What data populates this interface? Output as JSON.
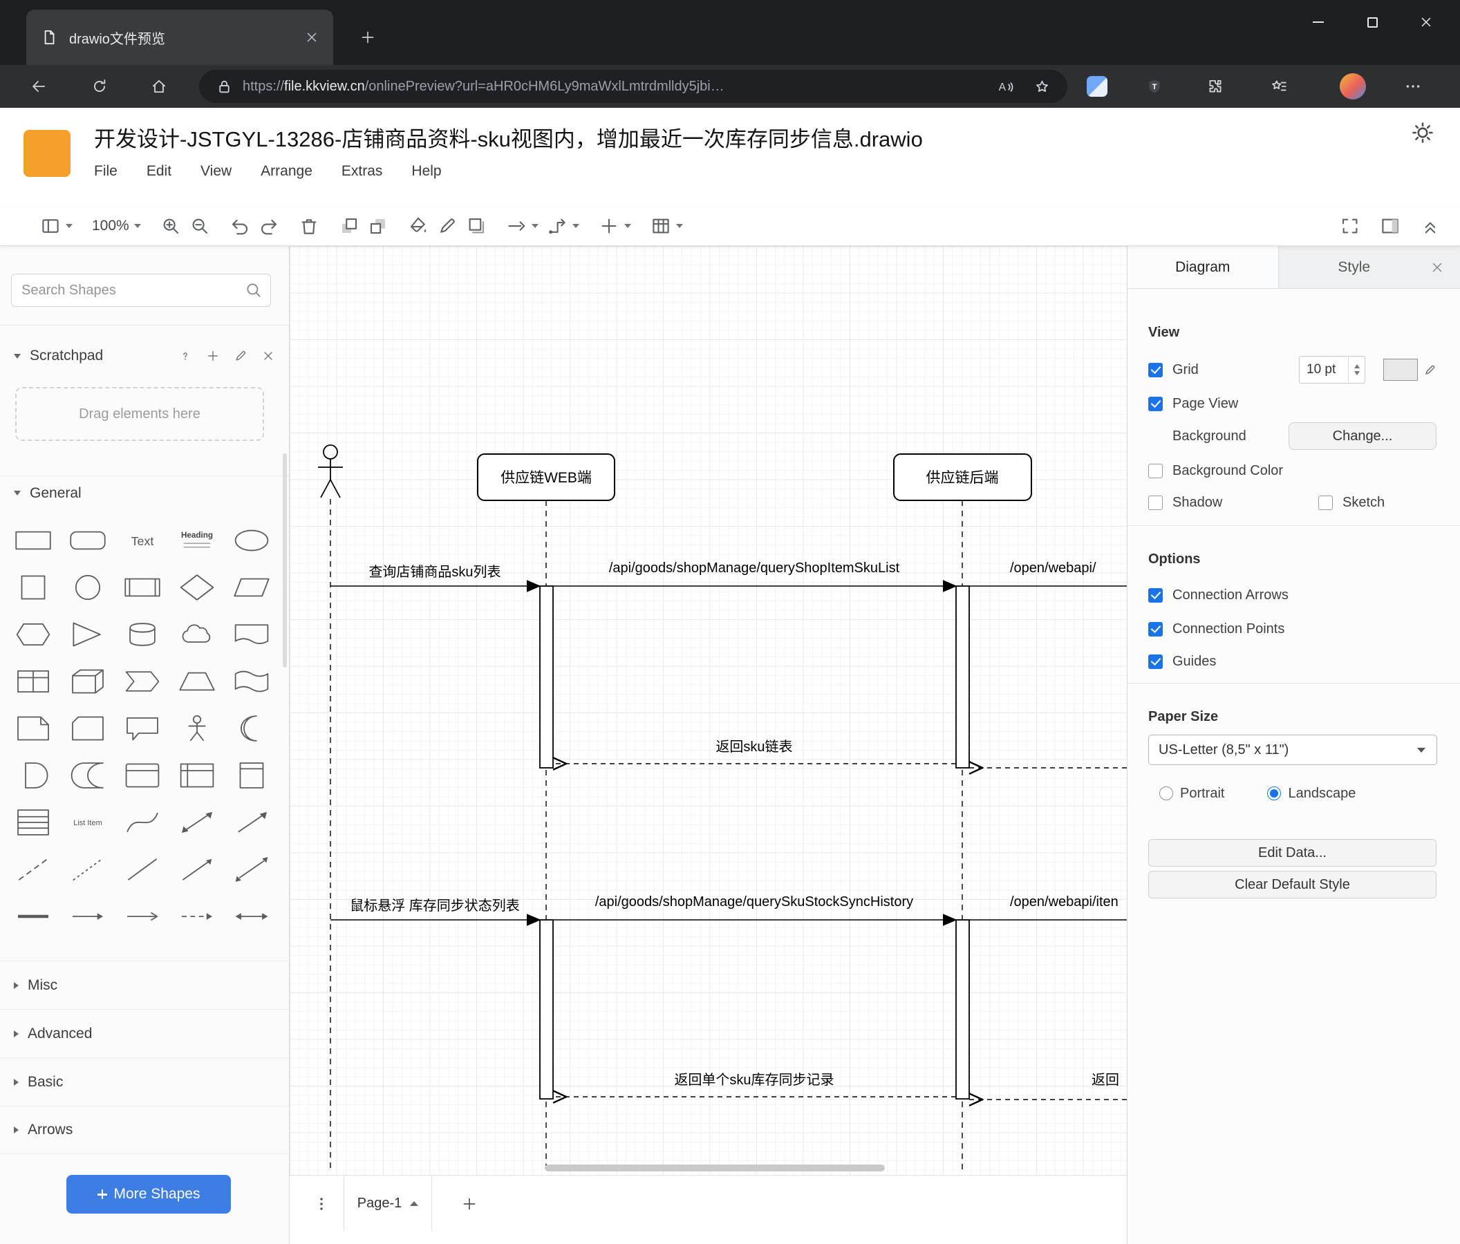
{
  "colors": {
    "accent": "#1a73e8",
    "logo_orange": "#F5A02B",
    "button_blue": "#3D7DE4"
  },
  "browser": {
    "tab_title": "drawio文件预览",
    "url_protocol": "https://",
    "url_domain": "file.kkview.cn",
    "url_path": "/onlinePreview?url=aHR0cHM6Ly9maWxlLmtrdmlldy5jbi…"
  },
  "app": {
    "doc_title": "开发设计-JSTGYL-13286-店铺商品资料-sku视图内，增加最近一次库存同步信息.drawio",
    "menu": [
      "File",
      "Edit",
      "View",
      "Arrange",
      "Extras",
      "Help"
    ]
  },
  "toolbar": {
    "zoom_level": "100%",
    "left": [
      {
        "name": "view-mode",
        "icon": "page-view",
        "caret": true,
        "group": true
      },
      {
        "name": "zoom-level",
        "zoom": true,
        "caret": true,
        "group": true
      },
      {
        "name": "zoom-in",
        "icon": "zoom-in",
        "group": true
      },
      {
        "name": "zoom-out",
        "icon": "zoom-out"
      },
      {
        "name": "undo",
        "icon": "undo",
        "group": true
      },
      {
        "name": "redo",
        "icon": "redo"
      },
      {
        "name": "delete",
        "icon": "delete",
        "group": true
      },
      {
        "name": "to-front",
        "icon": "to-front",
        "group": true
      },
      {
        "name": "to-back",
        "icon": "to-back"
      },
      {
        "name": "fill-color",
        "icon": "fill-color",
        "group": true
      },
      {
        "name": "line-color",
        "icon": "line-color"
      },
      {
        "name": "shadow",
        "icon": "shadow"
      },
      {
        "name": "connection",
        "icon": "connection",
        "caret": true,
        "group": true
      },
      {
        "name": "waypoints",
        "icon": "waypoints",
        "caret": true
      },
      {
        "name": "insert",
        "icon": "insert",
        "caret": true,
        "group": true
      },
      {
        "name": "insert-table",
        "icon": "table",
        "caret": true,
        "group": true
      }
    ],
    "right": [
      {
        "name": "fullscreen",
        "icon": "fullscreen"
      },
      {
        "name": "toggle-format-panel",
        "icon": "format-panel"
      },
      {
        "name": "collapse-toolbar",
        "icon": "collapse"
      }
    ]
  },
  "sidebar": {
    "search_placeholder": "Search Shapes",
    "scratchpad_label": "Scratchpad",
    "scratchpad_hint": "Drag elements here",
    "sections": [
      "General",
      "Misc",
      "Advanced",
      "Basic",
      "Arrows"
    ],
    "more_shapes": "More Shapes",
    "shapes": [
      "rectangle",
      "rounded-rectangle",
      "text",
      "heading",
      "ellipse",
      "square",
      "circle",
      "process",
      "diamond",
      "parallelogram",
      "hexagon",
      "triangle",
      "cylinder",
      "cloud",
      "document",
      "table",
      "cube",
      "step",
      "trapezoid",
      "tape",
      "note",
      "card",
      "callout",
      "actor",
      "or",
      "and",
      "data-storage",
      "container",
      "internal-storage",
      "vertical-container",
      "list",
      "list-item",
      "curve",
      "bidirectional-arrow",
      "diagonal-arrow",
      "dashed-line",
      "dotted-line",
      "line",
      "line-arrow",
      "double-line-arrow",
      "link",
      "simple-arrow",
      "thin-arrow",
      "dashed-arrow",
      "horizontal-double-arrow"
    ]
  },
  "diagram": {
    "lifeline_web": "供应链WEB端",
    "lifeline_backend": "供应链后端",
    "msg_query_sku_list": "查询店铺商品sku列表",
    "msg_api_query_sku_list": "/api/goods/shopManage/queryShopItemSkuList",
    "msg_open_webapi_1": "/open/webapi/",
    "msg_return_sku_list": "返回sku链表",
    "msg_hover_sync_list": "鼠标悬浮 库存同步状态列表",
    "msg_api_query_sync_history": "/api/goods/shopManage/querySkuStockSyncHistory",
    "msg_open_webapi_2": "/open/webapi/iten",
    "msg_return_sync_record": "返回单个sku库存同步记录",
    "msg_return_clipped": "返回"
  },
  "pagebar": {
    "page_name": "Page-1"
  },
  "format": {
    "tab_diagram": "Diagram",
    "tab_style": "Style",
    "view_title": "View",
    "grid_label": "Grid",
    "grid_size": "10 pt",
    "page_view_label": "Page View",
    "background_label": "Background",
    "change_button": "Change...",
    "background_color_label": "Background Color",
    "shadow_label": "Shadow",
    "sketch_label": "Sketch",
    "options_title": "Options",
    "connection_arrows_label": "Connection Arrows",
    "connection_points_label": "Connection Points",
    "guides_label": "Guides",
    "paper_title": "Paper Size",
    "paper_size": "US-Letter (8,5\" x 11\")",
    "portrait_label": "Portrait",
    "landscape_label": "Landscape",
    "edit_data_button": "Edit Data...",
    "clear_style_button": "Clear Default Style",
    "states": {
      "grid": true,
      "page_view": true,
      "background_color": false,
      "shadow": false,
      "sketch": false,
      "connection_arrows": true,
      "connection_points": true,
      "guides": true,
      "portrait": false,
      "landscape": true
    }
  }
}
